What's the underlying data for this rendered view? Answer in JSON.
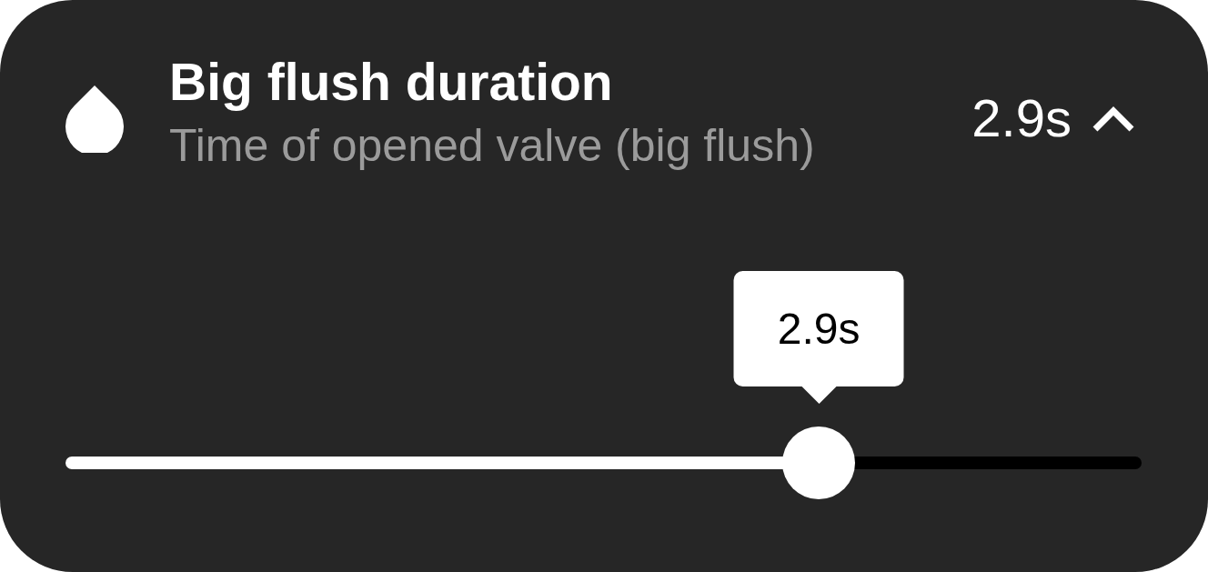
{
  "setting": {
    "title": "Big flush duration",
    "subtitle": "Time of opened valve (big flush)",
    "value": "2.9s",
    "expanded": true
  },
  "slider": {
    "level": 0.7,
    "tooltip": "2.9s"
  }
}
